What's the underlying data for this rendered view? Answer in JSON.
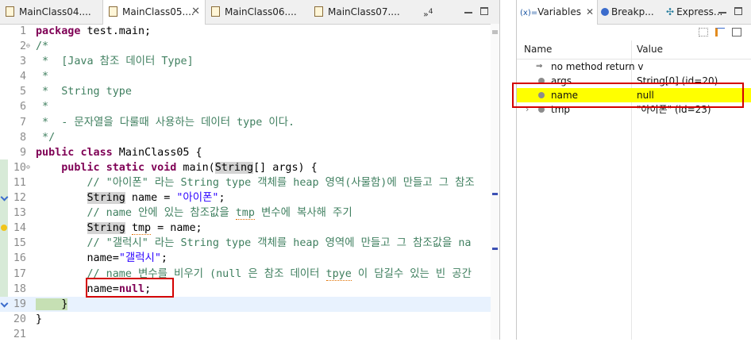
{
  "editor": {
    "tabs": [
      {
        "label": "MainClass04....",
        "active": false
      },
      {
        "label": "MainClass05....",
        "active": true
      },
      {
        "label": "MainClass06....",
        "active": false
      },
      {
        "label": "MainClass07....",
        "active": false
      }
    ],
    "tab_overflow": "»",
    "tab_overflow_count": "4",
    "lines": [
      {
        "n": "1"
      },
      {
        "n": "2"
      },
      {
        "n": "3"
      },
      {
        "n": "4"
      },
      {
        "n": "5"
      },
      {
        "n": "6"
      },
      {
        "n": "7"
      },
      {
        "n": "8"
      },
      {
        "n": "9"
      },
      {
        "n": "10"
      },
      {
        "n": "11"
      },
      {
        "n": "12"
      },
      {
        "n": "13"
      },
      {
        "n": "14"
      },
      {
        "n": "15"
      },
      {
        "n": "16"
      },
      {
        "n": "17"
      },
      {
        "n": "18"
      },
      {
        "n": "19"
      },
      {
        "n": "20"
      },
      {
        "n": "21"
      }
    ],
    "code": {
      "l1_kw": "package",
      "l1_rest": " test.main;",
      "l2": "/*",
      "l3": " *  [Java 참조 데이터 Type]",
      "l4": " *",
      "l5": " *  String type",
      "l6": " *",
      "l7": " *  - 문자열을 다룰때 사용하는 데이터 type 이다.",
      "l8": " */",
      "l9_kw1": "public",
      "l9_kw2": "class",
      "l9_rest": " MainClass05 {",
      "l10_indent": "    ",
      "l10_kw1": "public",
      "l10_kw2": "static",
      "l10_kw3": "void",
      "l10_a": " main(",
      "l10_type": "String",
      "l10_b": "[] args) {",
      "l11": "        // \"아이폰\" 라는 String type 객체를 heap 영역(사물함)에 만들고 그 참조",
      "l12_indent": "        ",
      "l12_type": "String",
      "l12_a": " name = ",
      "l12_str": "\"아이폰\"",
      "l12_b": ";",
      "l13_a": "        // name 안에 있는 참조값을 ",
      "l13_tmp": "tmp",
      "l13_b": " 변수에 복사해 주기",
      "l14_indent": "        ",
      "l14_type": "String",
      "l14_sp": " ",
      "l14_tmp": "tmp",
      "l14_rest": " = name;",
      "l15": "        // \"갤럭시\" 라는 String type 객체를 heap 영역에 만들고 그 참조값을 na",
      "l16_a": "        name=",
      "l16_str": "\"갤럭시\"",
      "l16_b": ";",
      "l17_a": "        // name 변수를 비우기 (null 은 참조 데이터 ",
      "l17_typo": "tpye",
      "l17_b": " 이 담길수 있는 빈 공간",
      "l18_a": "        name=",
      "l18_kw": "null",
      "l18_b": ";",
      "l19_indent": "    ",
      "l19_brace": "}",
      "l20": "}",
      "l21": ""
    }
  },
  "variables_view": {
    "tabs": [
      {
        "prefix": "(x)=",
        "label": "Variables",
        "active": true
      },
      {
        "label": "Breakp...",
        "active": false
      },
      {
        "label": "Express...",
        "active": false
      }
    ],
    "columns": {
      "name": "Name",
      "value": "Value"
    },
    "rows": [
      {
        "name": "no method return v",
        "value": "",
        "kind": "return"
      },
      {
        "name": "args",
        "value": "String[0]  (id=20)",
        "kind": "local"
      },
      {
        "name": "name",
        "value": "null",
        "kind": "local",
        "selected": true
      },
      {
        "name": "tmp",
        "value": "\"아이폰\" (id=23)",
        "kind": "local",
        "expandable": true
      }
    ]
  },
  "colors": {
    "keyword": "#7f0055",
    "comment": "#3f7f5f",
    "string": "#2a00ff",
    "highlight_box": "#d40000",
    "selected_row": "#ffff00"
  }
}
